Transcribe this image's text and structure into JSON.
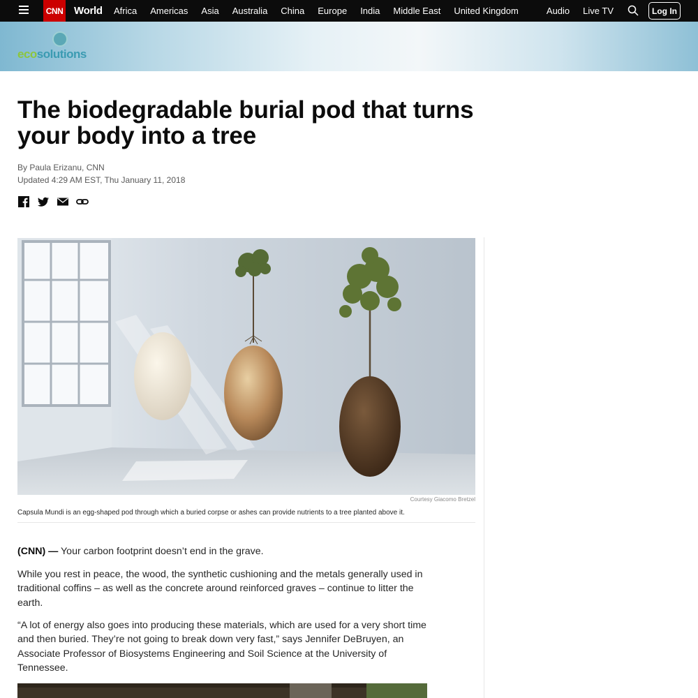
{
  "nav": {
    "section": "World",
    "logo": "CNN",
    "links": [
      "Africa",
      "Americas",
      "Asia",
      "Australia",
      "China",
      "Europe",
      "India",
      "Middle East",
      "United Kingdom"
    ],
    "right_links": [
      "Audio",
      "Live TV"
    ],
    "login_label": "Log In",
    "icons": {
      "menu": "hamburger-icon",
      "search": "search-icon"
    }
  },
  "banner": {
    "logo_part1": "eco",
    "logo_part2": "solutions",
    "colors": {
      "eco": "#8cc63e",
      "solutions": "#3b9bb2"
    }
  },
  "article": {
    "headline": "The biodegradable burial pod that turns your body into a tree",
    "byline": "By Paula Erizanu, CNN",
    "updated": "Updated 4:29 AM EST, Thu January 11, 2018",
    "share_icons": [
      "facebook-icon",
      "twitter-icon",
      "email-icon",
      "link-icon"
    ],
    "hero": {
      "credit": "Courtesy Giacomo Bretzel",
      "caption": "Capsula Mundi is an egg-shaped pod through which a buried corpse or ashes can provide nutrients to a tree planted above it."
    },
    "body": {
      "p1_tag": "(CNN) —",
      "p1_text": " Your carbon footprint doesn’t end in the grave.",
      "p2": "While you rest in peace, the wood, the synthetic cushioning and the metals generally used in traditional coffins – as well as the concrete around reinforced graves – continue to litter the earth.",
      "p3": "“A lot of energy also goes into producing these materials, which are used for a very short time and then buried. They’re not going to break down very fast,” says Jennifer DeBruyen, an Associate Professor of Biosystems Engineering and Soil Science at the University of Tennessee."
    }
  },
  "colors": {
    "nav_bg": "#0c0c0c",
    "cnn_red": "#cc0000"
  }
}
